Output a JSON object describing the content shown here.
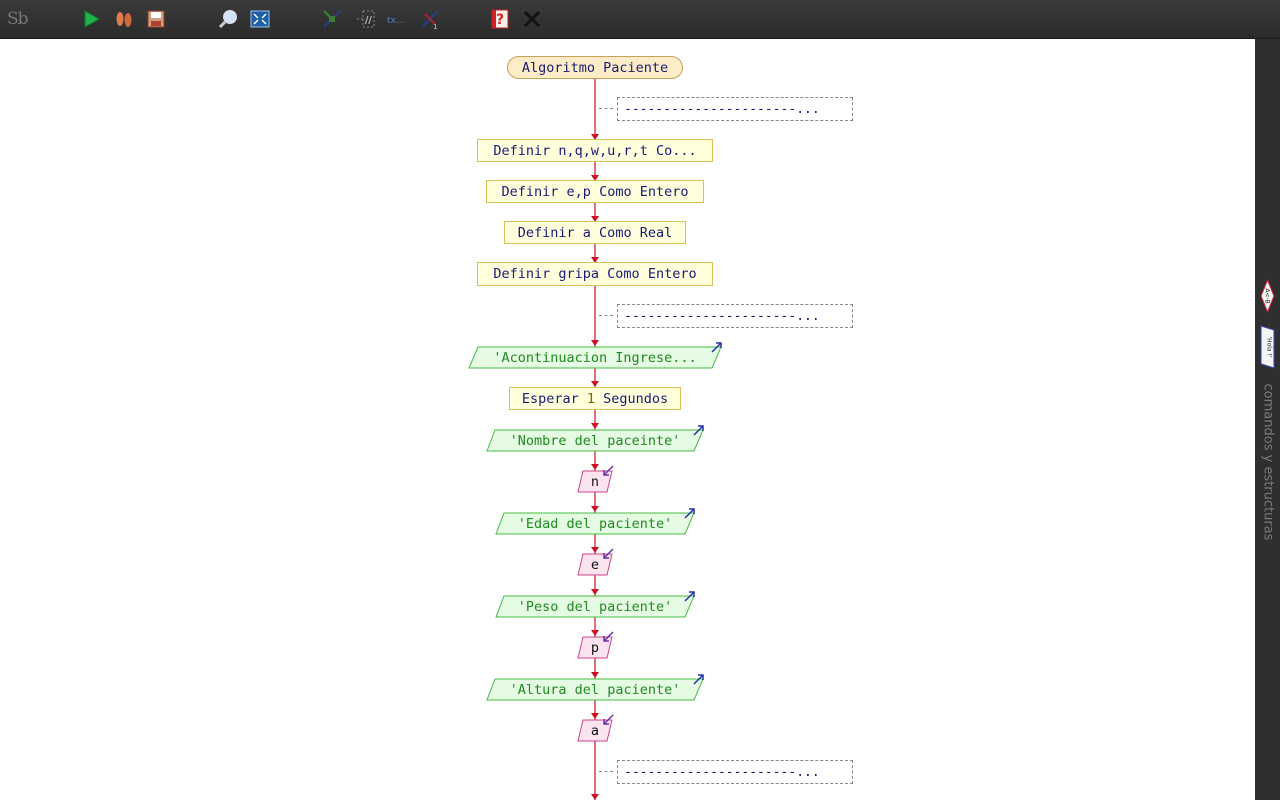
{
  "app": {
    "logo_text": "Sb"
  },
  "toolbar": {
    "buttons": [
      {
        "name": "run-icon",
        "label": "Ejecutar"
      },
      {
        "name": "step-icon",
        "label": "Paso a paso"
      },
      {
        "name": "save-icon",
        "label": "Guardar"
      },
      {
        "name": "zoom-icon",
        "label": "Zoom"
      },
      {
        "name": "fit-icon",
        "label": "Ajustar"
      },
      {
        "name": "edit-icon",
        "label": "Editar"
      },
      {
        "name": "comment-toggle-icon",
        "label": "//"
      },
      {
        "name": "text-icon",
        "label": "tx..."
      },
      {
        "name": "edit2-icon",
        "label": "Editar"
      },
      {
        "name": "help-icon",
        "label": "?"
      },
      {
        "name": "close-icon",
        "label": "Cerrar"
      }
    ]
  },
  "diagram": {
    "title": "Algoritmo Paciente",
    "comment_text": "----------------------",
    "comment_more": "...",
    "def1": "Definir n,q,w,u,r,t Co...",
    "def2": "Definir e,p Como Entero",
    "def3": "Definir a Como Real",
    "def4": "Definir gripa Como Entero",
    "out1": "'Acontinuacion Ingrese...",
    "wait_pre": "Esperar",
    "wait_num": "1",
    "wait_post": "Segundos",
    "out2": "'Nombre del paceinte'",
    "in1": "n",
    "out3": "'Edad del paciente'",
    "in2": "e",
    "out4": "'Peso del paciente'",
    "in3": "p",
    "out5": "'Altura del paciente'",
    "in4": "a"
  },
  "sidepanel": {
    "label": "comandos y estructuras",
    "btn1": "A<-B",
    "btn2": "'Hola !'"
  },
  "colors": {
    "flow_line": "#cc1122",
    "output_fill": "#e6fbe4",
    "output_border": "#44bb44",
    "input_fill": "#fbe3ef",
    "input_border": "#cc4488"
  }
}
